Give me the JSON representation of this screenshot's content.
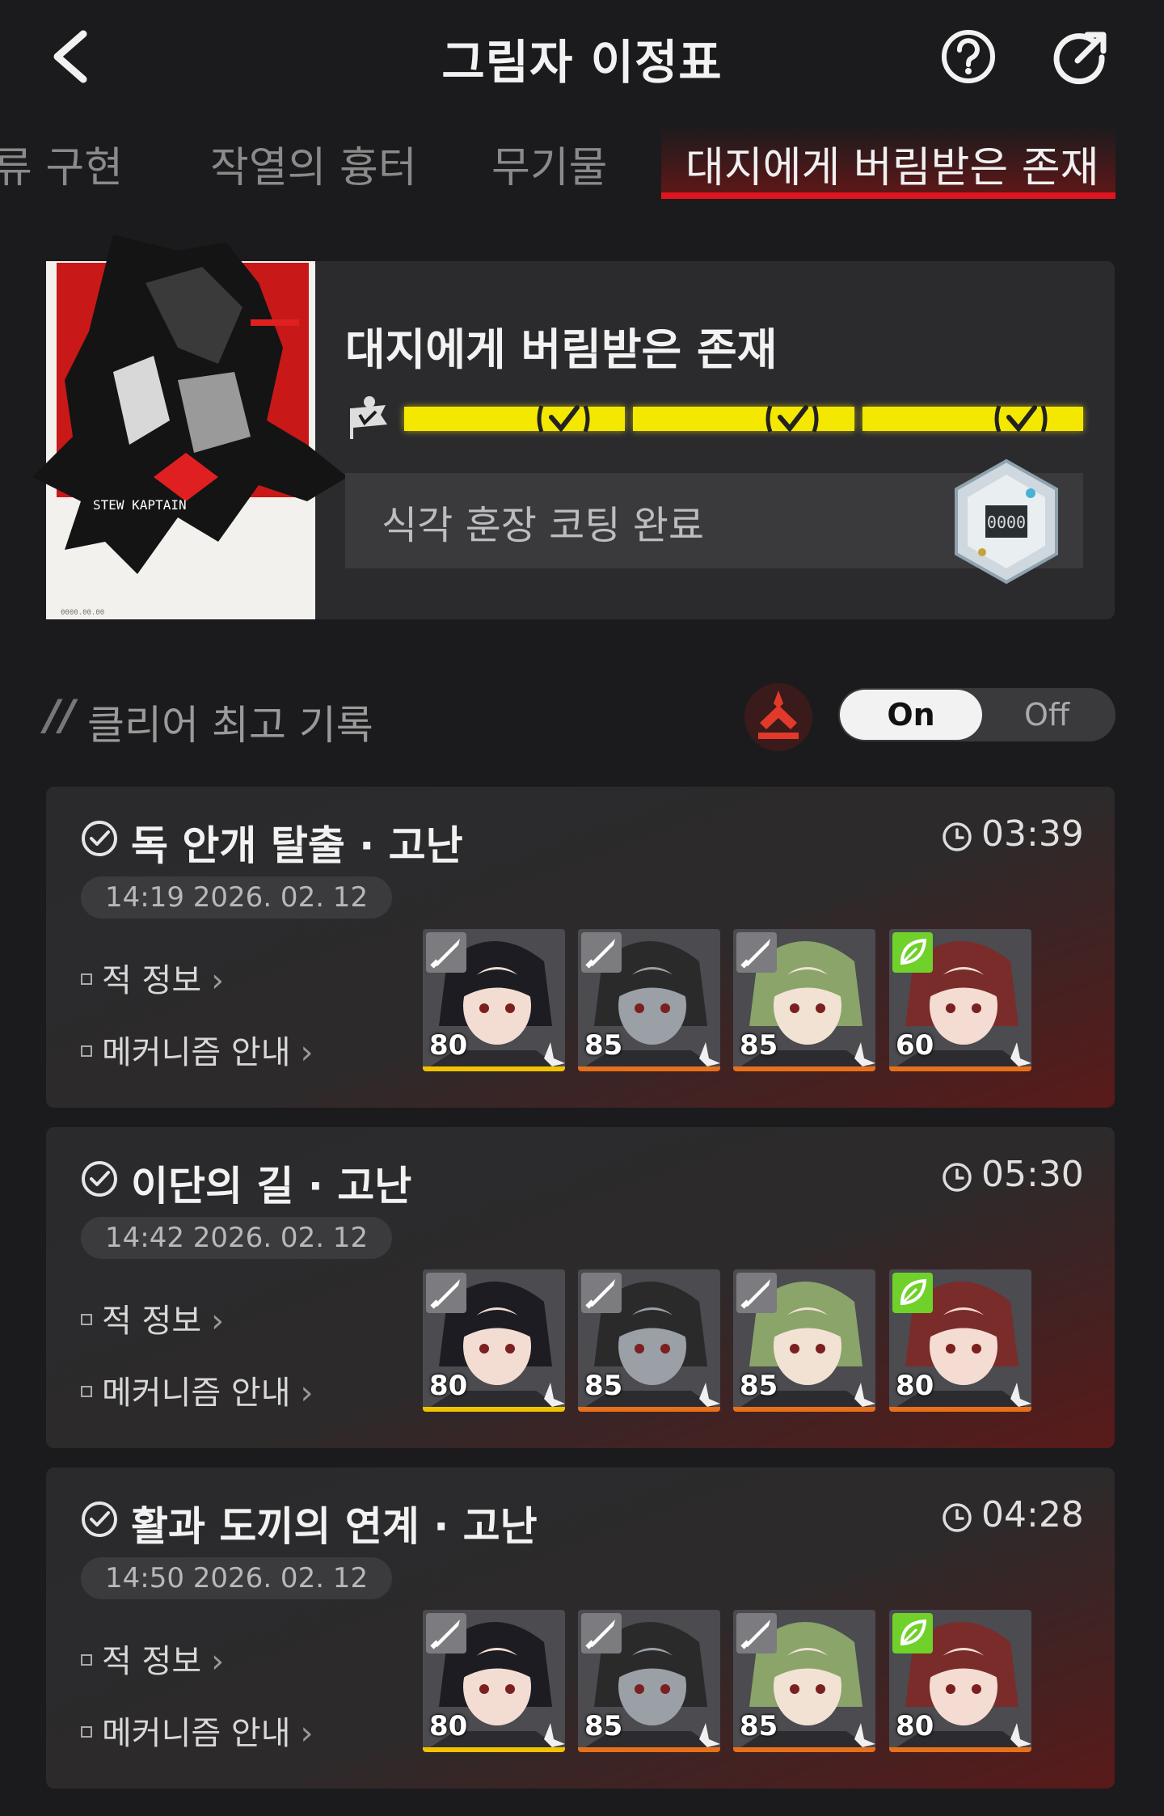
{
  "header": {
    "title": "그림자 이정표"
  },
  "tabs": [
    {
      "label": "류 구현",
      "active": false
    },
    {
      "label": "작열의 흉터",
      "active": false
    },
    {
      "label": "무기물",
      "active": false
    },
    {
      "label": "대지에게 버림받은 존재",
      "active": true
    }
  ],
  "stage": {
    "name": "대지에게 버림받은 존재",
    "progress_segments": 3,
    "progress_completed": 3,
    "reward_text": "식각 훈장 코팅 완료"
  },
  "records": {
    "title": "클리어 최고 기록",
    "toggle_on": "On",
    "toggle_off": "Off",
    "toggle_state": "On",
    "items": [
      {
        "title": "독 안개 탈출 · 고난",
        "time": "03:39",
        "date": "14:19 2026. 02. 12",
        "enemy_info": "적 정보",
        "mechanism": "메커니즘 안내",
        "team": [
          {
            "level": "80",
            "type": "striker",
            "bar": "#f2c200"
          },
          {
            "level": "85",
            "type": "striker",
            "bar": "#e8701a"
          },
          {
            "level": "85",
            "type": "striker",
            "bar": "#e8701a"
          },
          {
            "level": "60",
            "type": "support",
            "bar": "#e8701a"
          }
        ]
      },
      {
        "title": "이단의 길 · 고난",
        "time": "05:30",
        "date": "14:42 2026. 02. 12",
        "enemy_info": "적 정보",
        "mechanism": "메커니즘 안내",
        "team": [
          {
            "level": "80",
            "type": "striker",
            "bar": "#f2c200"
          },
          {
            "level": "85",
            "type": "striker",
            "bar": "#e8701a"
          },
          {
            "level": "85",
            "type": "striker",
            "bar": "#e8701a"
          },
          {
            "level": "80",
            "type": "support",
            "bar": "#e8701a"
          }
        ]
      },
      {
        "title": "활과 도끼의 연계 · 고난",
        "time": "04:28",
        "date": "14:50 2026. 02. 12",
        "enemy_info": "적 정보",
        "mechanism": "메커니즘 안내",
        "team": [
          {
            "level": "80",
            "type": "striker",
            "bar": "#f2c200"
          },
          {
            "level": "85",
            "type": "striker",
            "bar": "#e8701a"
          },
          {
            "level": "85",
            "type": "striker",
            "bar": "#e8701a"
          },
          {
            "level": "80",
            "type": "support",
            "bar": "#e8701a"
          }
        ]
      }
    ]
  },
  "colors": {
    "accent_red": "#e0141e",
    "progress_yellow": "#f4e800",
    "support_green": "#6fd12a"
  }
}
